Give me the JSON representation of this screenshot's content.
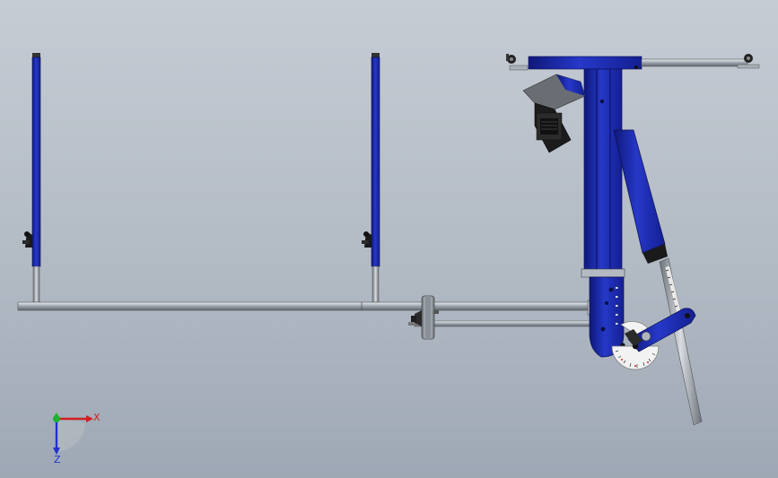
{
  "app": {
    "view": "cad-model-viewport"
  },
  "triad": {
    "x_label": "X",
    "z_label": "Z",
    "colors": {
      "x": "#d42020",
      "y": "#20b030",
      "z": "#2030d0"
    }
  },
  "colors": {
    "background_top": "#c6ccd4",
    "background_bottom": "#9ea8b5",
    "frame_blue": "#1f2fb4",
    "frame_blue_dark": "#10197a",
    "steel": "#9aa0a8",
    "motor_dark": "#202020",
    "gauge_white": "#f2f2f2"
  }
}
